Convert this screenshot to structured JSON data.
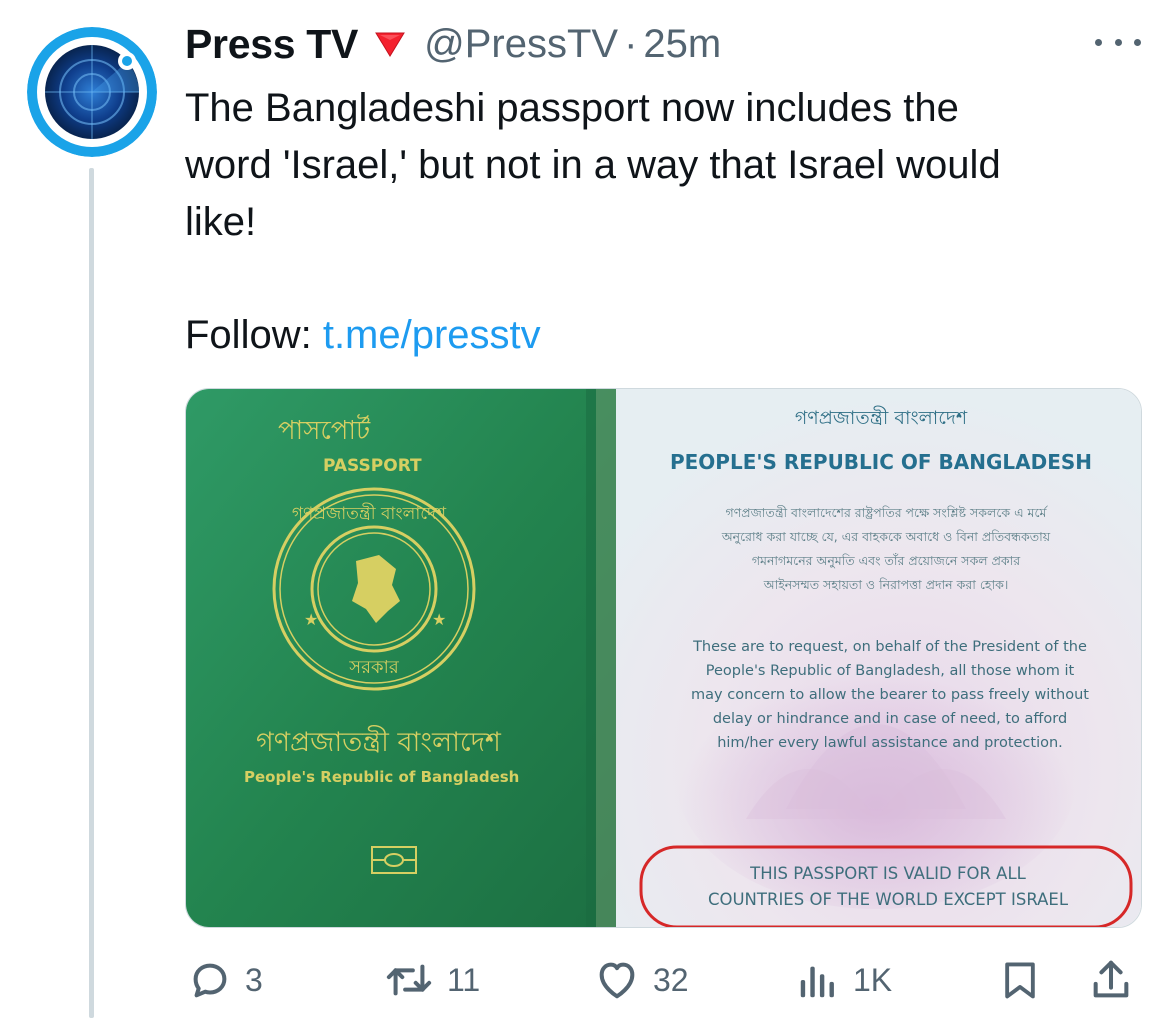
{
  "tweet": {
    "display_name": "Press TV",
    "handle": "@PressTV",
    "separator": "·",
    "time": "25m",
    "text_lines": [
      "The Bangladeshi passport now includes the",
      "word 'Israel,' but not in a way that Israel would",
      "like!"
    ],
    "follow_label": "Follow:",
    "follow_link": "t.me/presstv"
  },
  "media": {
    "cover_title_bn": "পাসপোর্ট",
    "cover_title_en": "PASSPORT",
    "emblem_top_bn": "গণপ্রজাতন্ত্রী বাংলাদেশ",
    "emblem_bottom_bn": "সরকার",
    "cover_country_bn": "গণপ্রজাতন্ত্রী বাংলাদেশ",
    "cover_country_en": "People's Republic of Bangladesh",
    "page_header_bn": "গণপ্রজাতন্ত্রী বাংলাদেশ",
    "page_header_en": "PEOPLE'S REPUBLIC OF BANGLADESH",
    "page_body_bn": [
      "গণপ্রজাতন্ত্রী বাংলাদেশের রাষ্ট্রপতির পক্ষে সংশ্লিষ্ট সকলকে এ মর্মে",
      "অনুরোধ করা যাচ্ছে যে, এর বাহককে অবাধে ও বিনা প্রতিবন্ধকতায়",
      "গমনাগমনের অনুমতি এবং তাঁর প্রয়োজনে সকল প্রকার",
      "আইনসম্মত সহায়তা ও নিরাপত্তা প্রদান করা হোক।"
    ],
    "page_body_en": [
      "These are to request, on behalf of the President of the",
      "People's Republic of Bangladesh, all those whom it",
      "may concern to allow the bearer to pass freely without",
      "delay or hindrance and in case of need, to afford",
      "him/her every lawful assistance and protection."
    ],
    "validity_lines": [
      "THIS PASSPORT IS VALID FOR ALL",
      "COUNTRIES OF THE WORLD EXCEPT ISRAEL"
    ]
  },
  "actions": {
    "replies": "3",
    "retweets": "11",
    "likes": "32",
    "views": "1K"
  },
  "colors": {
    "link": "#1d9bf0",
    "secondary_text": "#536471",
    "passport_green": "#2a8a5c",
    "gold": "#c9c24a",
    "validity_ring": "#d62828",
    "flag_red": "#f4212e"
  },
  "icons": {
    "avatar": "press-tv-logo",
    "flag": "red-triangle-down",
    "more": "more-horizontal-icon",
    "reply": "reply-icon",
    "retweet": "retweet-icon",
    "like": "heart-icon",
    "views": "views-icon",
    "bookmark": "bookmark-icon",
    "share": "share-icon"
  }
}
